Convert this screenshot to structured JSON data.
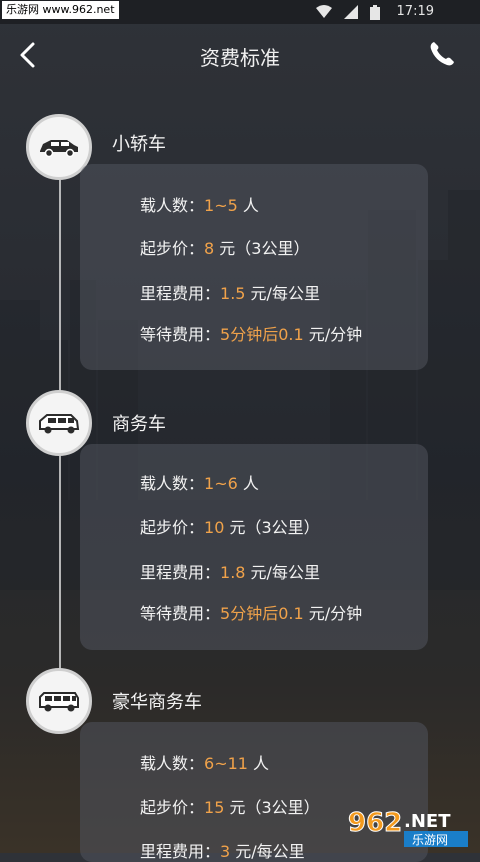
{
  "status_bar": {
    "watermark": "乐游网 www.962.net",
    "time": "17:19"
  },
  "header": {
    "title": "资费标准"
  },
  "vehicles": [
    {
      "name": "小轿车",
      "icon": "sedan-icon",
      "rows": {
        "passengers_label": "载人数：",
        "passengers_value": "1~5",
        "passengers_unit": " 人",
        "base_label": "起步价：",
        "base_value": "8",
        "base_unit": " 元（3公里）",
        "mileage_label": "里程费用：",
        "mileage_value": "1.5",
        "mileage_unit": " 元/每公里",
        "wait_label": "等待费用：",
        "wait_value": "5分钟后0.1",
        "wait_unit": " 元/分钟"
      }
    },
    {
      "name": "商务车",
      "icon": "mpv-icon",
      "rows": {
        "passengers_label": "载人数：",
        "passengers_value": "1~6",
        "passengers_unit": " 人",
        "base_label": "起步价：",
        "base_value": "10",
        "base_unit": " 元（3公里）",
        "mileage_label": "里程费用：",
        "mileage_value": "1.8",
        "mileage_unit": " 元/每公里",
        "wait_label": "等待费用：",
        "wait_value": "5分钟后0.1",
        "wait_unit": " 元/分钟"
      }
    },
    {
      "name": "豪华商务车",
      "icon": "van-icon",
      "rows": {
        "passengers_label": "载人数：",
        "passengers_value": "6~11",
        "passengers_unit": " 人",
        "base_label": "起步价：",
        "base_value": "15",
        "base_unit": " 元（3公里）",
        "mileage_label": "里程费用：",
        "mileage_value": "3",
        "mileage_unit": " 元/每公里"
      }
    }
  ],
  "watermark_logo": {
    "number": "962",
    "suffix": ".NET",
    "text": "乐游网"
  },
  "colors": {
    "accent": "#f0a24a",
    "text": "#f2f2f2",
    "card": "#50545c"
  }
}
